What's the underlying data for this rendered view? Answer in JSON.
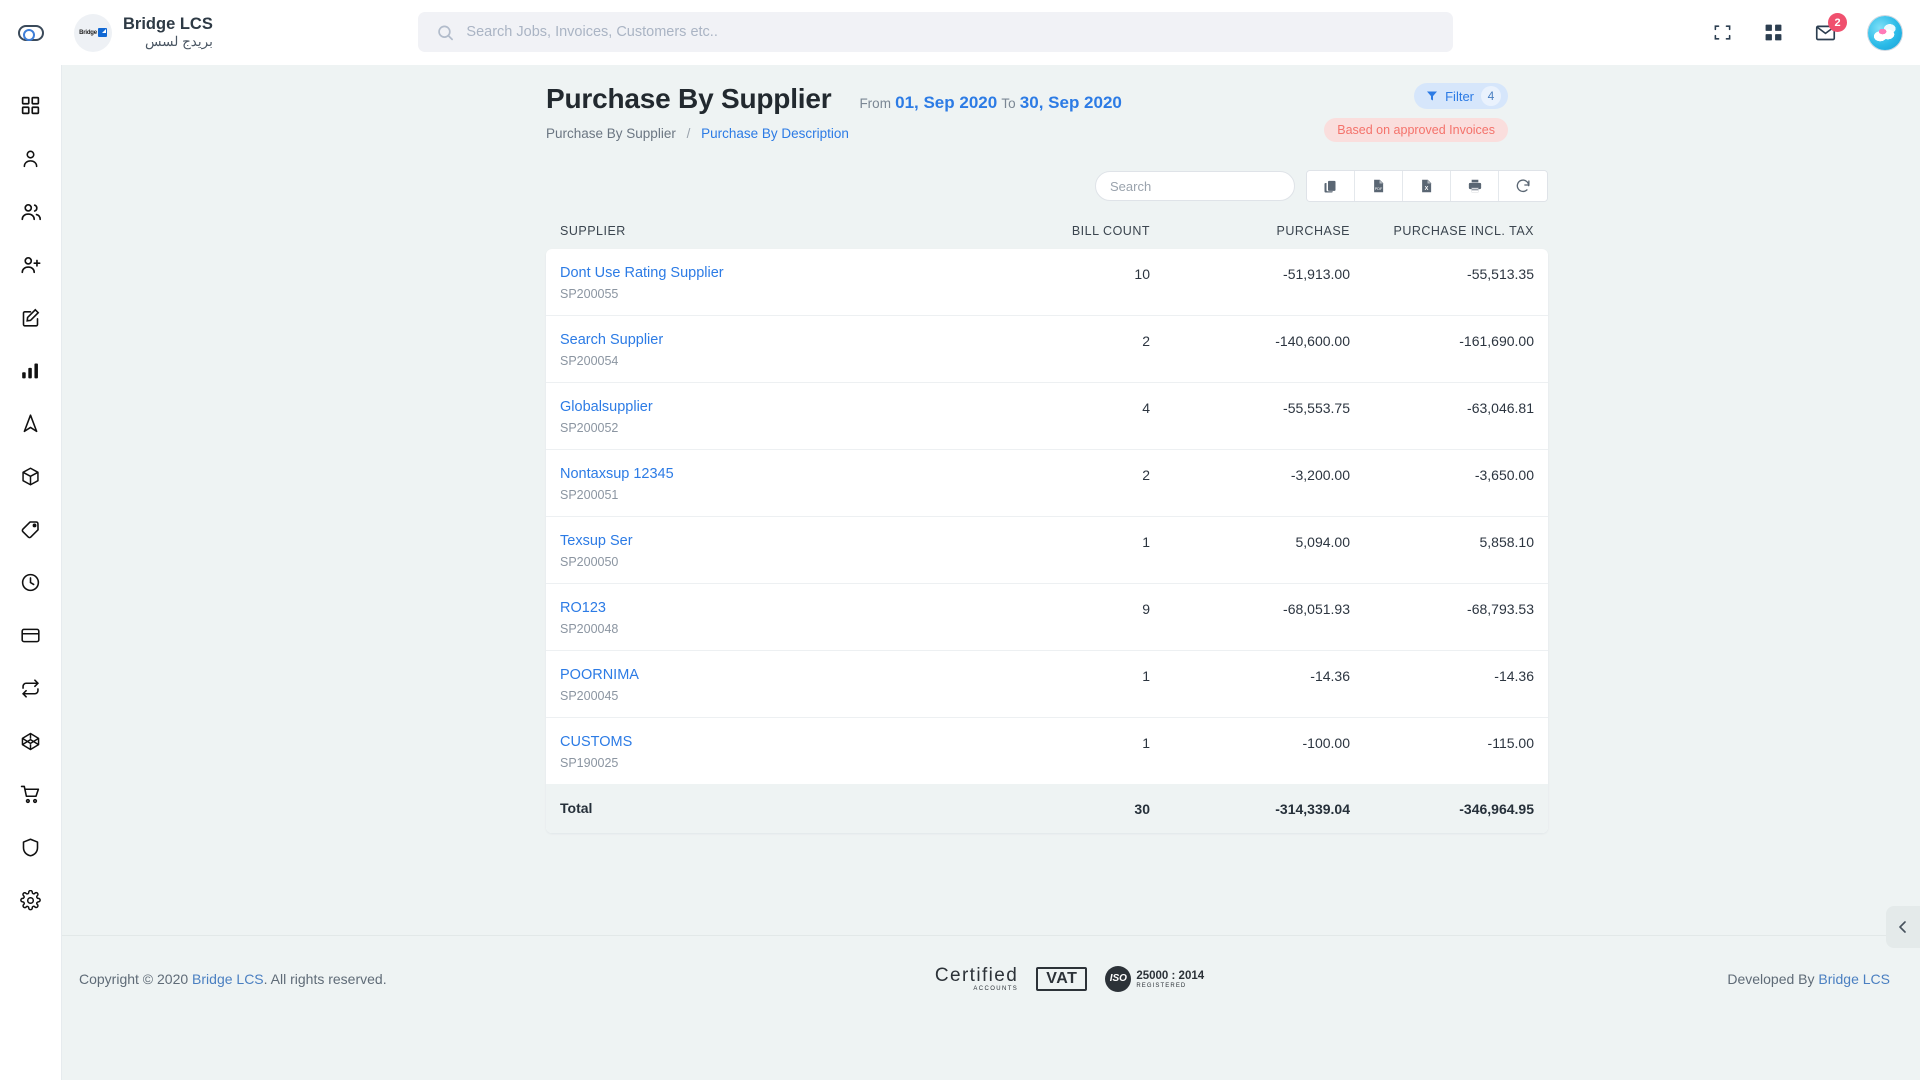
{
  "topbar": {
    "sidebar_toggle": "sidebar-toggle",
    "brand_name": "Bridge LCS",
    "brand_sub": "بريدج لسس",
    "brand_logo_text": "Bridge",
    "search_placeholder": "Search Jobs, Invoices, Customers etc..",
    "search_value": "",
    "mail_badge": "2"
  },
  "sidebar": {
    "items": [
      {
        "name": "dashboard",
        "icon": "grid-icon"
      },
      {
        "name": "user",
        "icon": "user-icon"
      },
      {
        "name": "customers",
        "icon": "users-icon"
      },
      {
        "name": "add-user",
        "icon": "user-plus-icon"
      },
      {
        "name": "edit",
        "icon": "edit-square-icon"
      },
      {
        "name": "reports",
        "icon": "bar-chart-icon"
      },
      {
        "name": "navigation",
        "icon": "navigation-icon"
      },
      {
        "name": "packages",
        "icon": "box-icon"
      },
      {
        "name": "tags",
        "icon": "tag-icon"
      },
      {
        "name": "history",
        "icon": "clock-icon"
      },
      {
        "name": "payments",
        "icon": "credit-card-icon"
      },
      {
        "name": "transfers",
        "icon": "repeat-icon"
      },
      {
        "name": "assets",
        "icon": "codepen-icon"
      },
      {
        "name": "purchase",
        "icon": "shopping-cart-icon"
      },
      {
        "name": "security",
        "icon": "shield-icon"
      },
      {
        "name": "settings",
        "icon": "gear-icon"
      }
    ]
  },
  "page": {
    "title": "Purchase By Supplier",
    "from_label": "From",
    "from_date": "01, Sep 2020",
    "to_label": "To",
    "to_date": "30, Sep 2020",
    "breadcrumb_current": "Purchase By Supplier",
    "breadcrumb_sep": "/",
    "breadcrumb_link": "Purchase By Description",
    "filter_label": "Filter",
    "filter_count": "4",
    "approved_note": "Based on approved Invoices"
  },
  "toolbar": {
    "search_placeholder": "Search",
    "search_value": "",
    "buttons": [
      {
        "name": "copy-button",
        "icon": "copy-icon"
      },
      {
        "name": "pdf-export-button",
        "icon": "pdf-file-icon"
      },
      {
        "name": "excel-export-button",
        "icon": "excel-file-icon"
      },
      {
        "name": "print-button",
        "icon": "printer-icon"
      },
      {
        "name": "refresh-button",
        "icon": "refresh-icon"
      }
    ]
  },
  "table": {
    "columns": [
      "SUPPLIER",
      "BILL COUNT",
      "PURCHASE",
      "PURCHASE INCL. TAX"
    ],
    "rows": [
      {
        "supplier": "Dont Use Rating Supplier",
        "code": "SP200055",
        "bill_count": "10",
        "purchase": "-51,913.00",
        "purchase_incl_tax": "-55,513.35"
      },
      {
        "supplier": "Search Supplier",
        "code": "SP200054",
        "bill_count": "2",
        "purchase": "-140,600.00",
        "purchase_incl_tax": "-161,690.00"
      },
      {
        "supplier": "Globalsupplier",
        "code": "SP200052",
        "bill_count": "4",
        "purchase": "-55,553.75",
        "purchase_incl_tax": "-63,046.81"
      },
      {
        "supplier": "Nontaxsup 12345",
        "code": "SP200051",
        "bill_count": "2",
        "purchase": "-3,200.00",
        "purchase_incl_tax": "-3,650.00"
      },
      {
        "supplier": "Texsup Ser",
        "code": "SP200050",
        "bill_count": "1",
        "purchase": "5,094.00",
        "purchase_incl_tax": "5,858.10"
      },
      {
        "supplier": "RO123",
        "code": "SP200048",
        "bill_count": "9",
        "purchase": "-68,051.93",
        "purchase_incl_tax": "-68,793.53"
      },
      {
        "supplier": "POORNIMA",
        "code": "SP200045",
        "bill_count": "1",
        "purchase": "-14.36",
        "purchase_incl_tax": "-14.36"
      },
      {
        "supplier": "CUSTOMS",
        "code": "SP190025",
        "bill_count": "1",
        "purchase": "-100.00",
        "purchase_incl_tax": "-115.00"
      }
    ],
    "total": {
      "label": "Total",
      "bill_count": "30",
      "purchase": "-314,339.04",
      "purchase_incl_tax": "-346,964.95"
    }
  },
  "footer": {
    "copyright_pre": "Copyright © 2020 ",
    "copyright_link": "Bridge LCS",
    "copyright_post": ". All rights reserved.",
    "cert_certified": "Certified",
    "cert_certified_sub": "ACCOUNTS",
    "cert_vat": "VAT",
    "cert_iso_seal": "ISO",
    "cert_iso_num": "25000 : 2014",
    "cert_iso_sub": "REGISTERED",
    "developed_pre": "Developed By ",
    "developed_link": "Bridge LCS"
  },
  "colors": {
    "accent": "#2c7be5",
    "bg": "#eef3f3",
    "badge_red": "#f0506e",
    "approved_bg": "#fadedd",
    "approved_fg": "#f4726b"
  }
}
